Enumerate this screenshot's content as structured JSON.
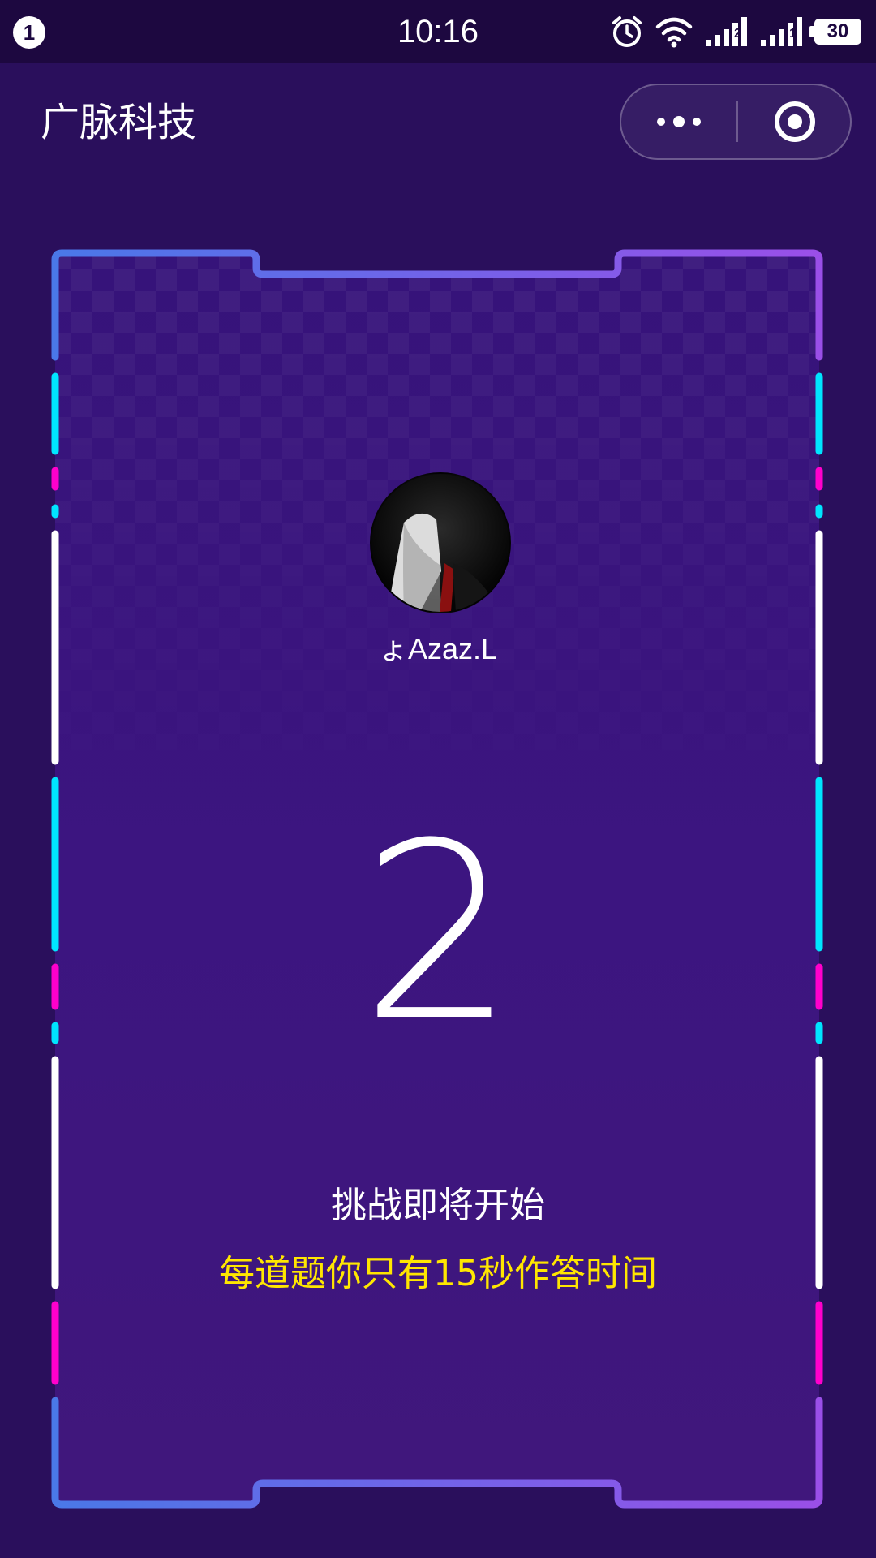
{
  "status_bar": {
    "notification_count": "1",
    "time": "10:16",
    "sim1_label": "2",
    "sim2_label": "1",
    "battery_level": "30",
    "icons": [
      "alarm-icon",
      "wifi-icon",
      "signal-icon",
      "signal-icon",
      "battery-icon"
    ]
  },
  "nav": {
    "title": "广脉科技",
    "capsule_icons": [
      "more-dots-icon",
      "target-close-icon"
    ]
  },
  "player": {
    "username": "ょAzaz.L",
    "avatar_icon": "avatar-suit-icon"
  },
  "countdown": {
    "value": "2",
    "title": "挑战即将开始",
    "hint": "每道题你只有15秒作答时间"
  },
  "theme": {
    "background": "#2a0f5c",
    "frame_gradient_start": "#4a78e8",
    "frame_gradient_end": "#9a4fe8",
    "accent_cyan": "#00e5ff",
    "accent_magenta": "#ff00cc",
    "hint_color": "#ffe600"
  }
}
